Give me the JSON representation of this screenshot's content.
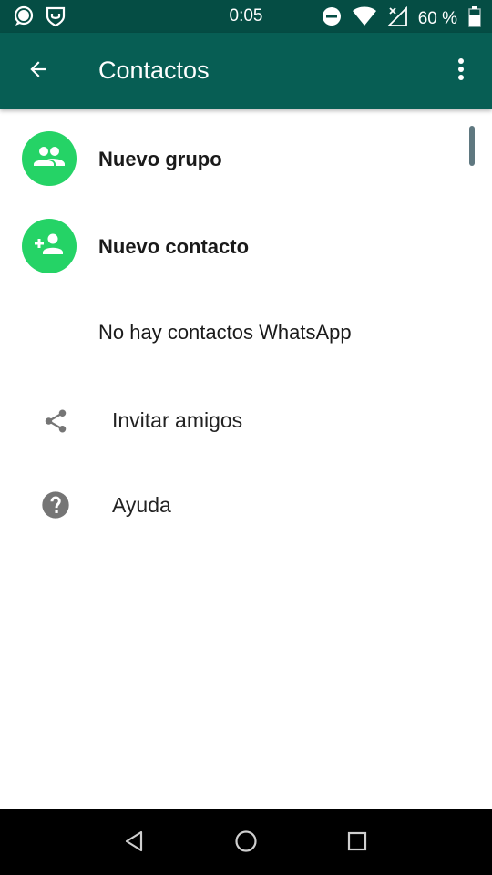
{
  "status_bar": {
    "time": "0:05",
    "battery_text": "60 %",
    "icons": [
      "signal-messenger-icon",
      "shield-app-icon",
      "do-not-disturb-icon",
      "wifi-icon",
      "no-signal-icon",
      "battery-icon"
    ]
  },
  "app_bar": {
    "title": "Contactos",
    "back_icon": "arrow-back-icon",
    "menu_icon": "more-vert-icon"
  },
  "list": {
    "new_group_label": "Nuevo grupo",
    "new_contact_label": "Nuevo contacto",
    "empty_message": "No hay contactos WhatsApp",
    "invite_label": "Invitar amigos",
    "help_label": "Ayuda"
  },
  "colors": {
    "status_bar": "#054d44",
    "app_bar": "#075e54",
    "accent_green": "#25d366",
    "icon_gray": "#757575"
  },
  "nav_bar": {
    "icons": [
      "back-triangle-icon",
      "home-circle-icon",
      "recents-square-icon"
    ]
  }
}
